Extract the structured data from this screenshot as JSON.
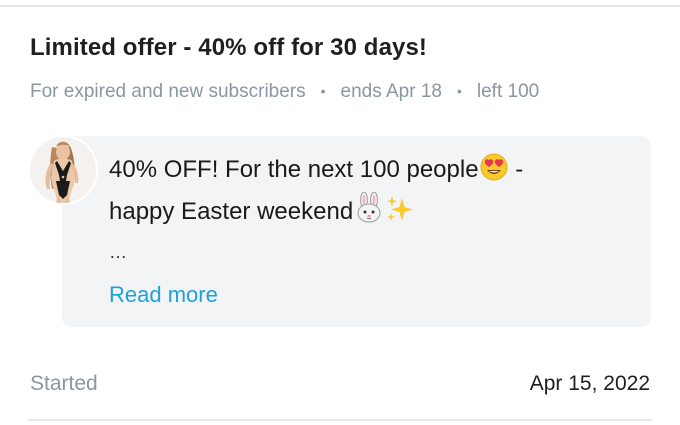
{
  "offer": {
    "title": "Limited offer - 40% off for 30 days!",
    "audience": "For expired and new subscribers",
    "separator": "•",
    "ends": "ends Apr 18",
    "left": "left 100"
  },
  "post": {
    "line1_text": "40% OFF! For the next 100 people",
    "line1_suffix": " -",
    "line2_text": "happy Easter weekend",
    "ellipsis": "…",
    "read_more": "Read more",
    "icons": [
      "heart-eyes-emoji-icon",
      "rabbit-face-emoji-icon",
      "sparkles-emoji-icon"
    ]
  },
  "footer": {
    "label": "Started",
    "value": "Apr 15, 2022"
  },
  "colors": {
    "accent": "#1da1d8",
    "muted": "#8a96a3",
    "card": "#f3f4f6"
  }
}
